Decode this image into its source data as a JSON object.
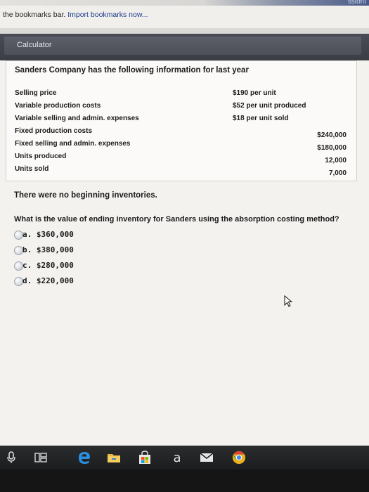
{
  "browser": {
    "url_fragment": "ssionI",
    "bookmark_bar": {
      "message": "the bookmarks bar.",
      "link": "Import bookmarks now..."
    }
  },
  "calculator": {
    "label": "Calculator"
  },
  "problem": {
    "title": "Sanders Company has the following information for last year",
    "rows": [
      {
        "label": "Selling price",
        "unit_value": "$190 per unit",
        "amount": ""
      },
      {
        "label": "Variable production costs",
        "unit_value": "$52 per unit produced",
        "amount": ""
      },
      {
        "label": "Variable selling and admin. expenses",
        "unit_value": "$18 per unit sold",
        "amount": ""
      },
      {
        "label": "Fixed production costs",
        "unit_value": "",
        "amount": "$240,000"
      },
      {
        "label": "Fixed selling and admin. expenses",
        "unit_value": "",
        "amount": "$180,000"
      },
      {
        "label": "Units produced",
        "unit_value": "",
        "amount": "12,000"
      },
      {
        "label": "Units sold",
        "unit_value": "",
        "amount": "7,000"
      }
    ],
    "note": "There were no beginning inventories.",
    "question": "What is the value of ending inventory for Sanders using the absorption costing method?",
    "options": [
      {
        "text": "a. $360,000"
      },
      {
        "text": "b. $380,000"
      },
      {
        "text": "c. $280,000"
      },
      {
        "text": "d. $220,000"
      }
    ]
  },
  "taskbar": {
    "icons": [
      "microphone-icon",
      "task-view-icon",
      "edge-icon",
      "file-explorer-icon",
      "store-icon",
      "amazon-icon",
      "mail-icon",
      "chrome-icon"
    ],
    "amazon_glyph": "a"
  },
  "colors": {
    "calculator_bar": "#3b3d45",
    "link": "#1a3d8c",
    "taskbar": "#1c1d1f"
  }
}
